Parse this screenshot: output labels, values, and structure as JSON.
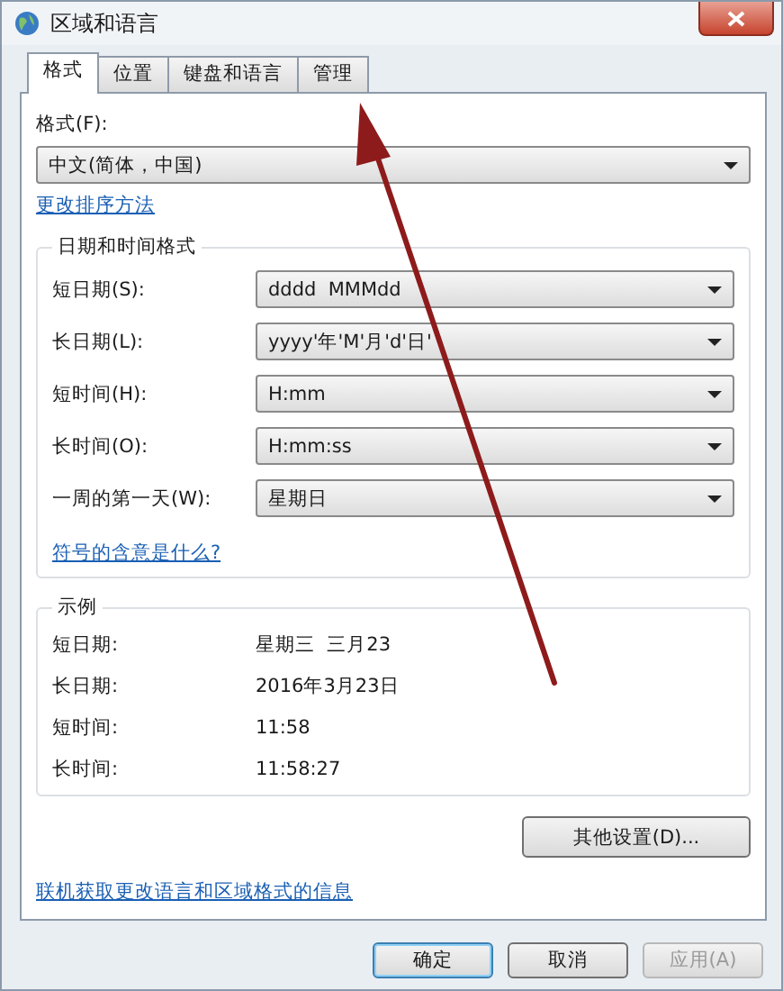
{
  "window": {
    "title": "区域和语言"
  },
  "tabs": [
    {
      "label": "格式",
      "selected": true
    },
    {
      "label": "位置",
      "selected": false
    },
    {
      "label": "键盘和语言",
      "selected": false
    },
    {
      "label": "管理",
      "selected": false
    }
  ],
  "format": {
    "label": "格式(F):",
    "value": "中文(简体，中国)",
    "link": "更改排序方法"
  },
  "date_time_formats": {
    "title": "日期和时间格式",
    "fields": [
      {
        "label": "短日期(S):",
        "value": "dddd  MMMdd"
      },
      {
        "label": "长日期(L):",
        "value": "yyyy'年'M'月'd'日'"
      },
      {
        "label": "短时间(H):",
        "value": "H:mm"
      },
      {
        "label": "长时间(O):",
        "value": "H:mm:ss"
      },
      {
        "label": "一周的第一天(W):",
        "value": "星期日"
      }
    ],
    "link": "符号的含意是什么?"
  },
  "examples": {
    "title": "示例",
    "rows": [
      {
        "label": "短日期:",
        "value": "星期三  三月23"
      },
      {
        "label": "长日期:",
        "value": "2016年3月23日"
      },
      {
        "label": "短时间:",
        "value": "11:58"
      },
      {
        "label": "长时间:",
        "value": "11:58:27"
      }
    ]
  },
  "additional_settings_button": "其他设置(D)...",
  "online_link": "联机获取更改语言和区域格式的信息",
  "buttons": [
    {
      "label": "确定",
      "kind": "default",
      "disabled": false
    },
    {
      "label": "取消",
      "kind": "normal",
      "disabled": false
    },
    {
      "label": "应用(A)",
      "kind": "normal",
      "disabled": true
    }
  ]
}
